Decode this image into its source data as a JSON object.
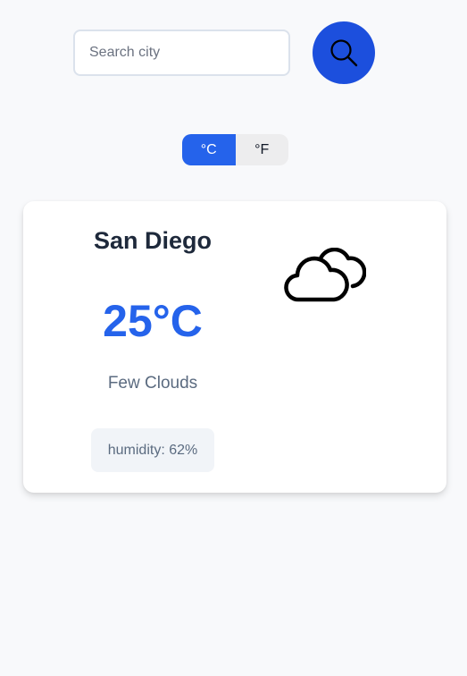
{
  "search": {
    "placeholder": "Search city",
    "value": "",
    "button_icon": "search-icon"
  },
  "units": {
    "options": [
      "°C",
      "°F"
    ],
    "selected": "°C"
  },
  "weather": {
    "city": "San Diego",
    "temperature": "25°C",
    "condition": "Few Clouds",
    "humidity": "humidity: 62%",
    "icon": "cloud-icon"
  },
  "colors": {
    "accent": "#2563eb",
    "search_button": "#1c4fdd",
    "background": "#f8f9fb",
    "card": "#ffffff"
  }
}
